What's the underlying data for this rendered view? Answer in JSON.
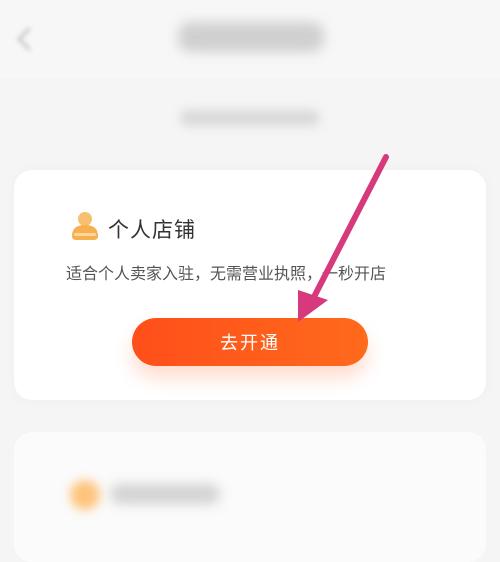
{
  "header": {
    "back_icon": "chevron-left-icon"
  },
  "card": {
    "icon": "shop-owner-icon",
    "icon_color": "#f7b45c",
    "title": "个人店铺",
    "description": "适合个人卖家入驻，无需营业执照，一秒开店",
    "button_label": "去开通",
    "button_color": "#ff5a1e"
  },
  "annotation": {
    "arrow_color": "#d63a7c",
    "arrow_icon": "pointer-arrow-icon"
  }
}
